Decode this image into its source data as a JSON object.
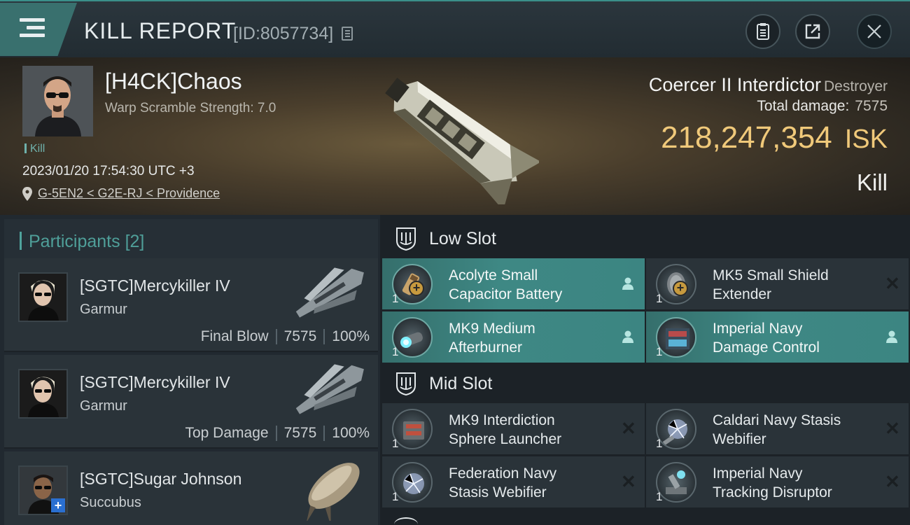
{
  "header": {
    "title": "KILL REPORT",
    "report_id": "[ID:8057734]"
  },
  "victim": {
    "pilot": "[H4CK]Chaos",
    "warp_scramble": "Warp Scramble Strength: 7.0",
    "tag": "Kill",
    "datetime": "2023/01/20 17:54:30 UTC +3",
    "location": "G-5EN2 < G2E-RJ < Providence",
    "ship_name": "Coercer II Interdictor",
    "ship_class": "Destroyer",
    "total_damage_label": "Total damage:",
    "total_damage_value": "7575",
    "isk_value": "218,247,354",
    "isk_unit": "ISK",
    "result": "Kill"
  },
  "participants": {
    "label": "Participants",
    "count": "[2]",
    "items": [
      {
        "name": "[SGTC]Mercykiller IV",
        "ship": "Garmur",
        "role": "Final Blow",
        "damage": "7575",
        "percent": "100%"
      },
      {
        "name": "[SGTC]Mercykiller IV",
        "ship": "Garmur",
        "role": "Top Damage",
        "damage": "7575",
        "percent": "100%"
      },
      {
        "name": "[SGTC]Sugar Johnson",
        "ship": "Succubus",
        "role": "",
        "damage": "",
        "percent": ""
      }
    ]
  },
  "slots": {
    "low": {
      "title": "Low Slot",
      "modules": [
        {
          "name_line1": "Acolyte Small",
          "name_line2": "Capacitor Battery",
          "qty": "1",
          "status": "person-icon"
        },
        {
          "name_line1": "MK5 Small Shield",
          "name_line2": "Extender",
          "qty": "1",
          "status": "x-icon"
        },
        {
          "name_line1": "MK9 Medium",
          "name_line2": "Afterburner",
          "qty": "1",
          "status": "person-icon"
        },
        {
          "name_line1": "Imperial Navy",
          "name_line2": "Damage Control",
          "qty": "1",
          "status": "person-icon"
        }
      ]
    },
    "mid": {
      "title": "Mid Slot",
      "modules": [
        {
          "name_line1": "MK9 Interdiction",
          "name_line2": "Sphere Launcher",
          "qty": "1",
          "status": "x-icon"
        },
        {
          "name_line1": "Caldari Navy Stasis",
          "name_line2": "Webifier",
          "qty": "1",
          "status": "x-icon"
        },
        {
          "name_line1": "Federation Navy",
          "name_line2": "Stasis Webifier",
          "qty": "1",
          "status": "x-icon"
        },
        {
          "name_line1": "Imperial Navy",
          "name_line2": "Tracking Disruptor",
          "qty": "1",
          "status": "x-icon"
        }
      ]
    }
  },
  "colors": {
    "accent": "#3e8884",
    "isk": "#f0c97a",
    "panel": "#2a3339"
  }
}
